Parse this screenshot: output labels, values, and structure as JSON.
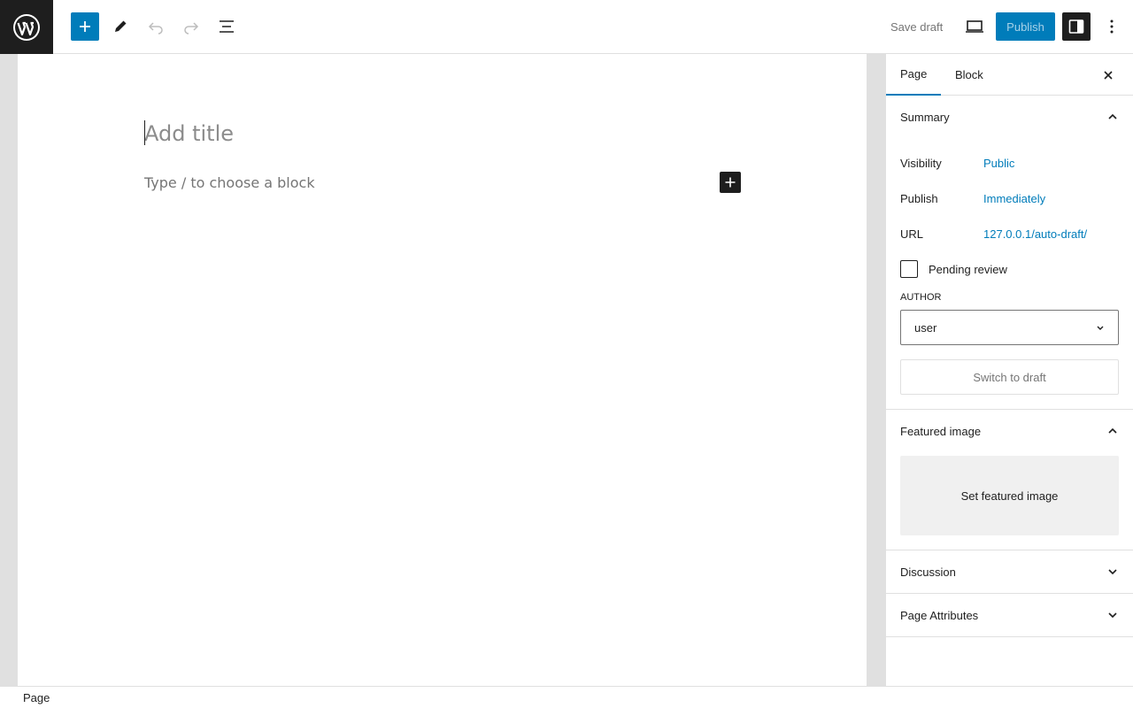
{
  "toolbar": {
    "save_draft_label": "Save draft",
    "publish_label": "Publish"
  },
  "editor": {
    "title_placeholder": "Add title",
    "block_placeholder": "Type / to choose a block"
  },
  "sidebar": {
    "tabs": [
      {
        "label": "Page",
        "active": true
      },
      {
        "label": "Block",
        "active": false
      }
    ],
    "summary": {
      "title": "Summary",
      "rows": [
        {
          "label": "Visibility",
          "value": "Public"
        },
        {
          "label": "Publish",
          "value": "Immediately"
        },
        {
          "label": "URL",
          "value": "127.0.0.1/auto-draft/"
        }
      ],
      "pending_review_label": "Pending review",
      "author_label": "AUTHOR",
      "author_value": "user",
      "switch_to_draft_label": "Switch to draft"
    },
    "featured_image": {
      "title": "Featured image",
      "button_label": "Set featured image"
    },
    "discussion": {
      "title": "Discussion"
    },
    "page_attributes": {
      "title": "Page Attributes"
    }
  },
  "footer": {
    "breadcrumb": "Page"
  },
  "colors": {
    "accent": "#007cba",
    "dark": "#1e1e1e"
  }
}
